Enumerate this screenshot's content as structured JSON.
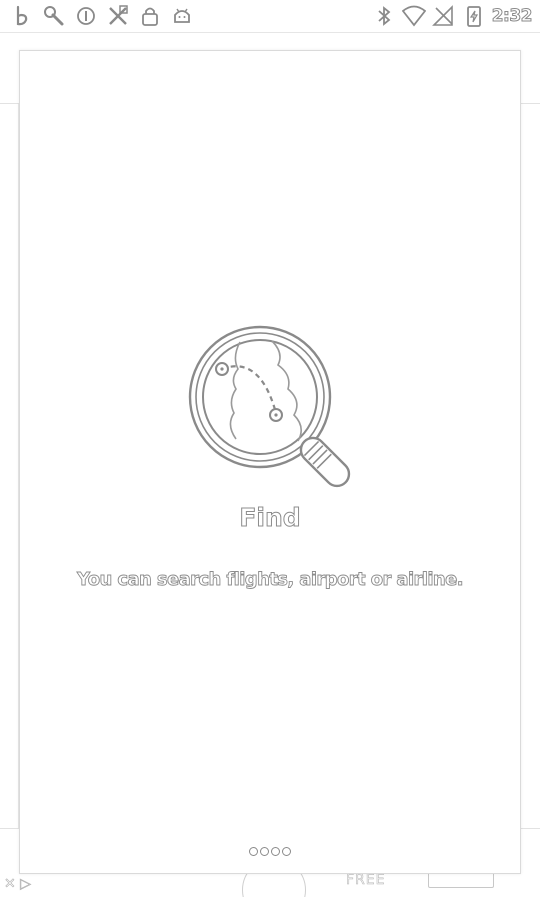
{
  "status_bar": {
    "left_icons": [
      "b-app-icon",
      "wrench-icon",
      "circle-info-icon",
      "crossed-tools-icon",
      "lock-icon",
      "android-icon"
    ],
    "right_icons": [
      "bluetooth-icon",
      "wifi-icon",
      "no-signal-icon",
      "battery-charging-icon"
    ],
    "time": "2:32"
  },
  "background_app": {
    "free_label": "FREE"
  },
  "onboarding": {
    "icon": "magnifier-map-icon",
    "title": "Find",
    "description": "You can search flights, airport or airline.",
    "pager": {
      "total_pages": 4,
      "current_page": 1
    }
  },
  "colors": {
    "outline": "#8a8a8a",
    "background": "#ffffff"
  }
}
